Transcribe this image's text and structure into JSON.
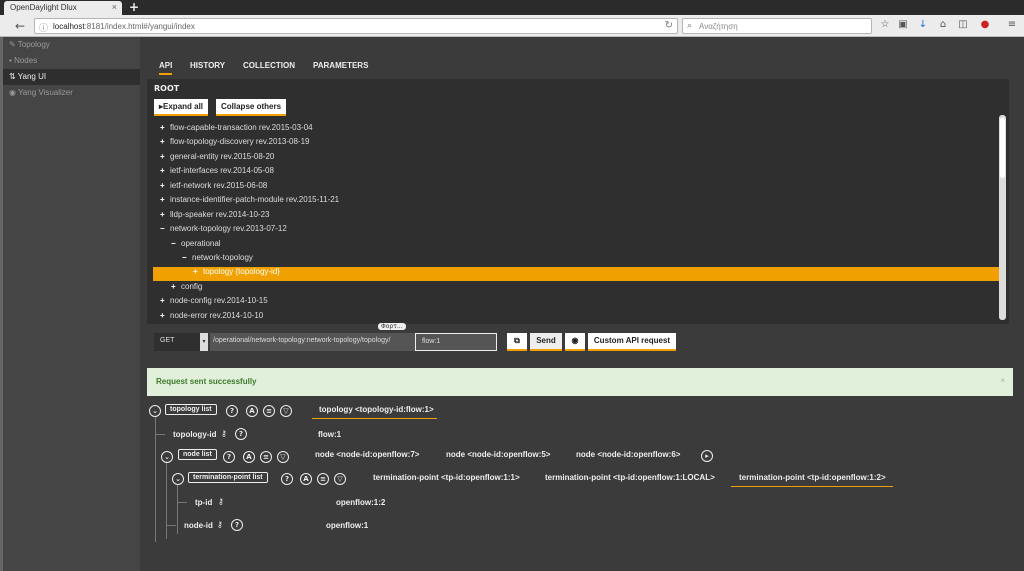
{
  "browser": {
    "tab_title": "OpenDaylight Dlux",
    "tab_close": "×",
    "new_tab": "+",
    "back": "←",
    "url_host": "localhost",
    "url_rest": ":8181/index.html#/yangui/index",
    "search_placeholder": "Αναζήτηση",
    "reload": "↻"
  },
  "sidebar": {
    "items": [
      {
        "label": "Topology"
      },
      {
        "label": "Nodes"
      },
      {
        "label": "Yang UI"
      },
      {
        "label": "Yang Visualizer"
      }
    ]
  },
  "tabs": [
    "API",
    "HISTORY",
    "COLLECTION",
    "PARAMETERS"
  ],
  "panel": {
    "root_label": "ROOT",
    "expand_all": "Expand all",
    "collapse_others": "Collapse others"
  },
  "tree": [
    {
      "sign": "+",
      "label": "flow-capable-transaction rev.2015-03-04"
    },
    {
      "sign": "+",
      "label": "flow-topology-discovery rev.2013-08-19"
    },
    {
      "sign": "+",
      "label": "general-entity rev.2015-08-20"
    },
    {
      "sign": "+",
      "label": "ietf-interfaces rev.2014-05-08"
    },
    {
      "sign": "+",
      "label": "ietf-network rev.2015-06-08"
    },
    {
      "sign": "+",
      "label": "instance-identifier-patch-module rev.2015-11-21"
    },
    {
      "sign": "+",
      "label": "lldp-speaker rev.2014-10-23"
    },
    {
      "sign": "−",
      "label": "network-topology rev.2013-07-12"
    },
    {
      "sign": "−",
      "label": "operational"
    },
    {
      "sign": "−",
      "label": "network-topology"
    },
    {
      "sign": "+",
      "label": "topology {topology-id}"
    },
    {
      "sign": "+",
      "label": "config"
    },
    {
      "sign": "+",
      "label": "node-config rev.2014-10-15"
    },
    {
      "sign": "+",
      "label": "node-error rev.2014-10-10"
    }
  ],
  "request": {
    "method": "GET",
    "path": "/operational/network-topology:network-topology/topology/",
    "path_value": "flow:1",
    "tooltip": "Φορτ...",
    "send": "Send",
    "custom": "Custom API request"
  },
  "status": {
    "message": "Request sent successfully",
    "close": "×"
  },
  "result": {
    "topology_list": "topology list",
    "topology_header": "topology <topology-id:flow:1>",
    "topology_id_label": "topology-id",
    "topology_id_value": "flow:1",
    "node_list": "node list",
    "nodes": [
      "node <node-id:openflow:7>",
      "node <node-id:openflow:5>",
      "node <node-id:openflow:6>"
    ],
    "tp_list": "termination-point list",
    "tps": [
      "termination-point <tp-id:openflow:1:1>",
      "termination-point <tp-id:openflow:1:LOCAL>",
      "termination-point <tp-id:openflow:1:2>"
    ],
    "tp_id_label": "tp-id",
    "tp_id_value": "openflow:1:2",
    "node_id_label": "node-id",
    "node_id_value": "openflow:1"
  },
  "colors": {
    "accent": "#f0a000",
    "success_bg": "#e1f0db",
    "success_text": "#3d7a2a"
  }
}
